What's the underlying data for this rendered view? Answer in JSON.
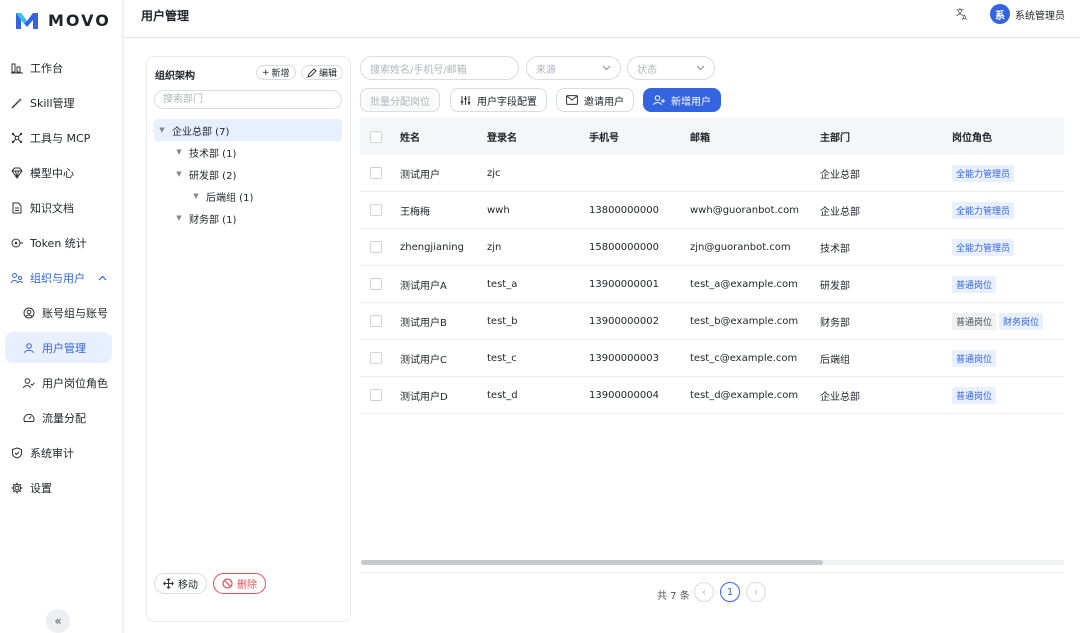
{
  "app": {
    "name": "MOVO"
  },
  "sidebar": {
    "items": [
      {
        "label": "工作台",
        "icon": "dashboard-icon"
      },
      {
        "label": "Skill管理",
        "icon": "wand-icon"
      },
      {
        "label": "工具与 MCP",
        "icon": "network-icon"
      },
      {
        "label": "模型中心",
        "icon": "diamond-icon"
      },
      {
        "label": "知识文档",
        "icon": "document-icon"
      },
      {
        "label": "Token 统计",
        "icon": "token-icon"
      },
      {
        "label": "组织与用户",
        "icon": "org-icon",
        "expanded": true
      },
      {
        "label": "账号组与账号",
        "icon": "account-icon",
        "sub": true
      },
      {
        "label": "用户管理",
        "icon": "user-icon",
        "sub": true,
        "active": true
      },
      {
        "label": "用户岗位角色",
        "icon": "user-role-icon",
        "sub": true
      },
      {
        "label": "流量分配",
        "icon": "gauge-icon",
        "sub": true
      },
      {
        "label": "系统审计",
        "icon": "shield-icon"
      },
      {
        "label": "设置",
        "icon": "gear-icon"
      }
    ],
    "collapse_label": "«"
  },
  "header": {
    "title": "用户管理",
    "avatar_text": "系",
    "username": "系统管理员"
  },
  "org": {
    "title": "组织架构",
    "add_label": "新增",
    "edit_label": "编辑",
    "search_placeholder": "搜索部门",
    "tree": [
      {
        "label": "企业总部 (7)",
        "level": 0,
        "caret": "▼",
        "selected": true
      },
      {
        "label": "技术部 (1)",
        "level": 1,
        "caret": "▼"
      },
      {
        "label": "研发部 (2)",
        "level": 1,
        "caret": "▼"
      },
      {
        "label": "后端组 (1)",
        "level": 2,
        "caret": "▼"
      },
      {
        "label": "财务部 (1)",
        "level": 1,
        "caret": "▼"
      }
    ],
    "move_label": "移动",
    "delete_label": "删除"
  },
  "filters": {
    "search_placeholder": "搜索姓名/手机号/邮箱",
    "source_placeholder": "来源",
    "status_placeholder": "状态"
  },
  "actions": {
    "batch_assign": "批量分配岗位",
    "field_config": "用户字段配置",
    "invite": "邀请用户",
    "add_user": "新增用户"
  },
  "table": {
    "columns": [
      "姓名",
      "登录名",
      "手机号",
      "邮箱",
      "主部门",
      "岗位角色"
    ],
    "rows": [
      {
        "name": "测试用户",
        "login": "zjc",
        "phone": "",
        "email": "",
        "dept": "企业总部",
        "roles": [
          {
            "label": "全能力管理员",
            "style": "blue"
          }
        ]
      },
      {
        "name": "王梅梅",
        "login": "wwh",
        "phone": "13800000000",
        "email": "wwh@guoranbot.com",
        "dept": "企业总部",
        "roles": [
          {
            "label": "全能力管理员",
            "style": "blue"
          }
        ]
      },
      {
        "name": "zhengjianing",
        "login": "zjn",
        "phone": "15800000000",
        "email": "zjn@guoranbot.com",
        "dept": "技术部",
        "roles": [
          {
            "label": "全能力管理员",
            "style": "blue"
          }
        ]
      },
      {
        "name": "测试用户A",
        "login": "test_a",
        "phone": "13900000001",
        "email": "test_a@example.com",
        "dept": "研发部",
        "roles": [
          {
            "label": "普通岗位",
            "style": "blue"
          }
        ]
      },
      {
        "name": "测试用户B",
        "login": "test_b",
        "phone": "13900000002",
        "email": "test_b@example.com",
        "dept": "财务部",
        "roles": [
          {
            "label": "普通岗位",
            "style": "gray"
          },
          {
            "label": "财务岗位",
            "style": "blue"
          }
        ]
      },
      {
        "name": "测试用户C",
        "login": "test_c",
        "phone": "13900000003",
        "email": "test_c@example.com",
        "dept": "后端组",
        "roles": [
          {
            "label": "普通岗位",
            "style": "blue"
          }
        ]
      },
      {
        "name": "测试用户D",
        "login": "test_d",
        "phone": "13900000004",
        "email": "test_d@example.com",
        "dept": "企业总部",
        "roles": [
          {
            "label": "普通岗位",
            "style": "blue"
          }
        ]
      }
    ]
  },
  "pagination": {
    "total_text": "共 7 条",
    "prev": "‹",
    "current": "1",
    "next": "›"
  },
  "colors": {
    "accent": "#3464e0",
    "danger": "#e74c5a"
  }
}
